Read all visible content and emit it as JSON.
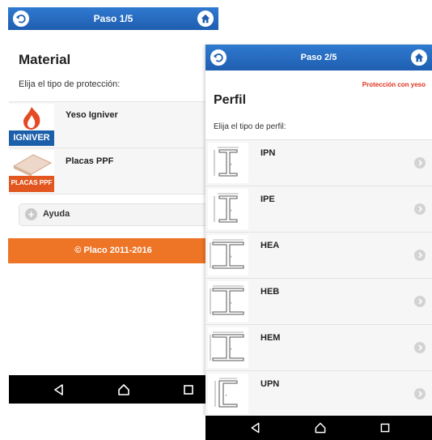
{
  "screen1": {
    "header": {
      "title": "Paso 1/5"
    },
    "heading": "Material",
    "subtitle": "Elija el tipo de protección:",
    "items": [
      {
        "label": "Yeso Igniver",
        "thumb_text": "IGNIVER",
        "thumb_color": "#d8432a"
      },
      {
        "label": "Placas PPF",
        "thumb_text": "PLACAS PPF",
        "thumb_color": "#e2571f"
      }
    ],
    "help_label": "Ayuda",
    "footer": "© Placo 2011-2016"
  },
  "screen2": {
    "header": {
      "title": "Paso 2/5"
    },
    "protection_note": "Protección con yeso",
    "heading": "Perfil",
    "subtitle": "Elija el tipo de perfil:",
    "items": [
      {
        "label": "IPN",
        "profile": "I"
      },
      {
        "label": "IPE",
        "profile": "I"
      },
      {
        "label": "HEA",
        "profile": "H"
      },
      {
        "label": "HEB",
        "profile": "H"
      },
      {
        "label": "HEM",
        "profile": "H"
      },
      {
        "label": "UPN",
        "profile": "U"
      }
    ]
  },
  "colors": {
    "header_blue": "#2a6fc5",
    "footer_orange": "#ee7426",
    "note_red": "#e0321d"
  },
  "icons": [
    "back-circle-icon",
    "home-icon",
    "plus-icon",
    "chevron-right-icon",
    "nav-back-icon",
    "nav-home-icon",
    "nav-recents-icon"
  ]
}
